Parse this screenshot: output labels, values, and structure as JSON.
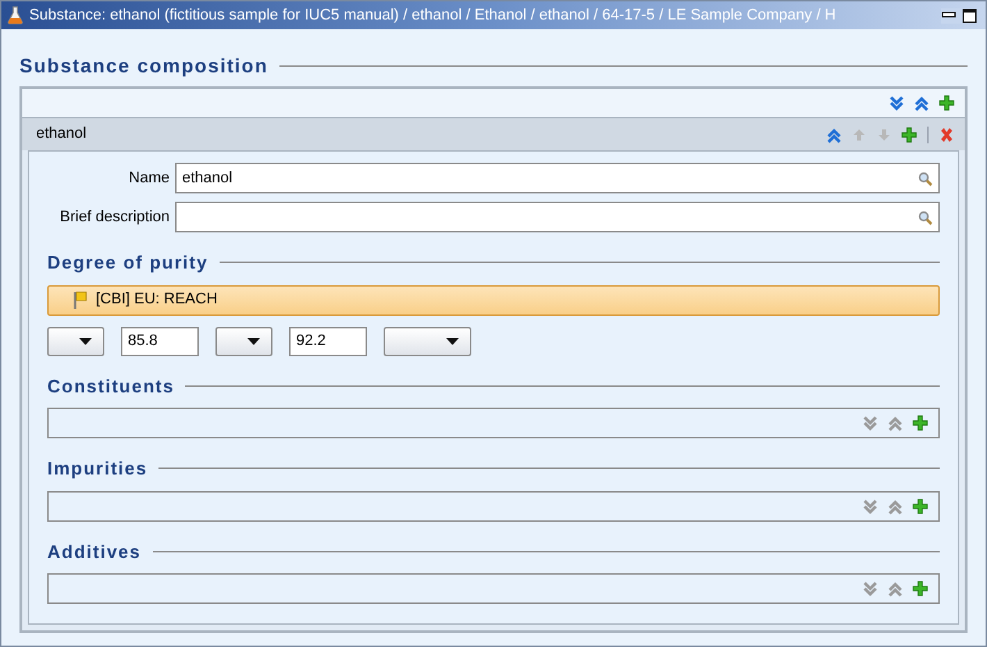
{
  "window": {
    "title": "Substance: ethanol (fictitious sample for IUC5 manual) / ethanol / Ethanol / ethanol / 64-17-5 / LE Sample Company / H"
  },
  "composition": {
    "title": "Substance composition",
    "toolbar": [
      {
        "kind": "expand",
        "disabled": false
      },
      {
        "kind": "collapse",
        "disabled": false
      },
      {
        "kind": "add",
        "disabled": false
      }
    ],
    "entry": {
      "name": "ethanol",
      "toolbar": [
        {
          "kind": "collapse",
          "disabled": false
        },
        {
          "kind": "up",
          "disabled": true
        },
        {
          "kind": "down",
          "disabled": true
        },
        {
          "kind": "add",
          "disabled": false
        },
        {
          "kind": "separator"
        },
        {
          "kind": "delete",
          "disabled": false
        }
      ],
      "fields": [
        {
          "label": "Name",
          "value": "ethanol"
        },
        {
          "label": "Brief description"
        }
      ],
      "purity": {
        "title": "Degree of purity",
        "flag": "[CBI] EU: REACH",
        "controls": [
          {
            "kind": "select"
          },
          {
            "kind": "input",
            "value": "85.8"
          },
          {
            "kind": "select"
          },
          {
            "kind": "input",
            "value": "92.2"
          },
          {
            "kind": "select",
            "wide": true
          }
        ]
      },
      "sections": [
        {
          "title": "Constituents",
          "toolbar": [
            {
              "kind": "expand",
              "disabled": true
            },
            {
              "kind": "collapse",
              "disabled": true
            },
            {
              "kind": "add",
              "disabled": false
            }
          ]
        },
        {
          "title": "Impurities",
          "toolbar": [
            {
              "kind": "expand",
              "disabled": true
            },
            {
              "kind": "collapse",
              "disabled": true
            },
            {
              "kind": "add",
              "disabled": false
            }
          ]
        },
        {
          "title": "Additives",
          "toolbar": [
            {
              "kind": "expand",
              "disabled": true
            },
            {
              "kind": "collapse",
              "disabled": true
            },
            {
              "kind": "add",
              "disabled": false
            }
          ]
        }
      ]
    }
  }
}
